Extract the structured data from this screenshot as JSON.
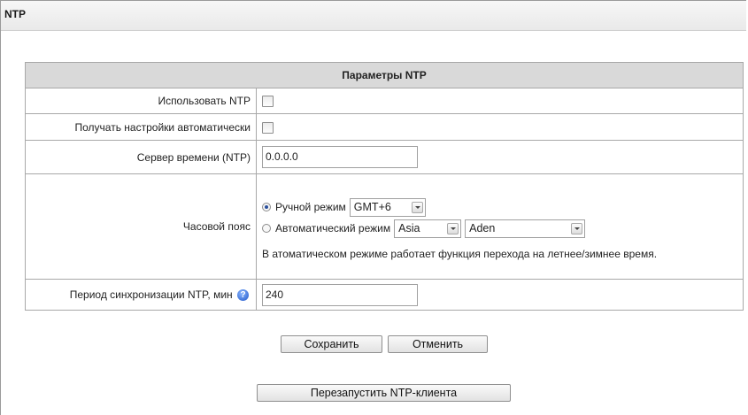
{
  "panel": {
    "title": "NTP"
  },
  "table": {
    "header": "Параметры NTP",
    "use_ntp": {
      "label": "Использовать NTP",
      "checked": false
    },
    "auto_settings": {
      "label": "Получать настройки автоматически",
      "checked": false
    },
    "server": {
      "label": "Сервер времени (NTP)",
      "value": "0.0.0.0"
    },
    "timezone": {
      "label": "Часовой пояс",
      "manual": {
        "label": "Ручной режим",
        "selected": true,
        "value": "GMT+6"
      },
      "auto": {
        "label": "Автоматический режим",
        "selected": false,
        "region": "Asia",
        "city": "Aden"
      },
      "note": "В атоматическом режиме работает функция перехода на летнее/зимнее время."
    },
    "sync_period": {
      "label": "Период синхронизации NTP, мин",
      "value": "240",
      "help_icon": "question-icon"
    }
  },
  "buttons": {
    "save": "Сохранить",
    "cancel": "Отменить",
    "restart": "Перезапустить NTP-клиента"
  }
}
